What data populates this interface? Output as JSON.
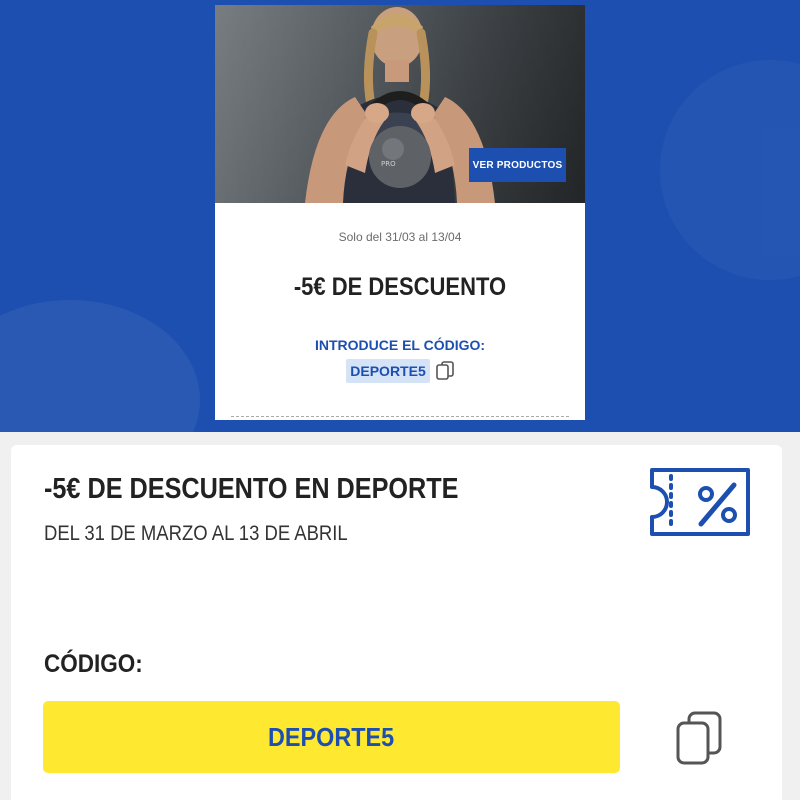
{
  "promo": {
    "button_label": "VER PRODUCTOS",
    "dates": "Solo del 31/03 al 13/04",
    "discount": "-5€ DE DESCUENTO",
    "code_label": "INTRODUCE EL CÓDIGO:",
    "code": "DEPORTE5",
    "copy_icon": "copy-icon",
    "image": "woman-with-kettlebell-photo"
  },
  "coupon": {
    "title": "-5€ DE DESCUENTO EN DEPORTE",
    "subtitle": "DEL 31 DE MARZO AL 13 DE ABRIL",
    "icon": "coupon-percent-icon",
    "code_label": "CÓDIGO:",
    "code": "DEPORTE5",
    "copy_icon": "copy-icon"
  },
  "colors": {
    "brand_blue": "#1d4fb0",
    "code_yellow": "#ffe930",
    "code_highlight": "#d5e3f6"
  }
}
